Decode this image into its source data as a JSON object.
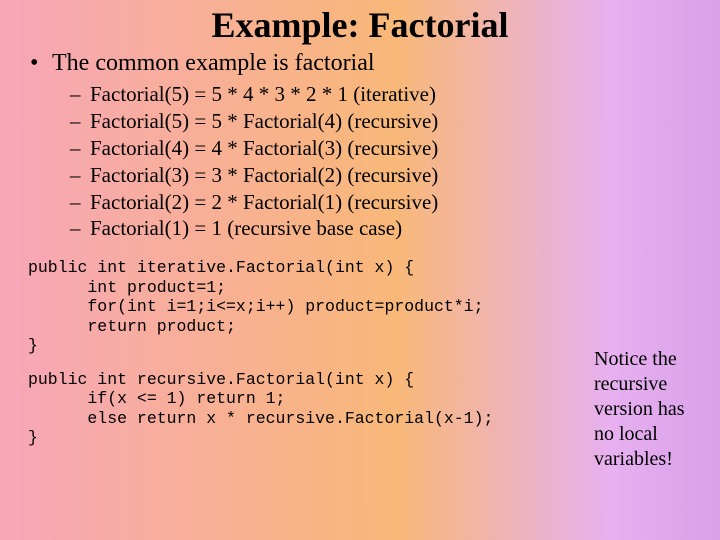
{
  "title": "Example:  Factorial",
  "bullet": "The common example is factorial",
  "subs": [
    "Factorial(5) = 5 * 4 * 3 * 2 * 1 (iterative)",
    "Factorial(5) = 5 * Factorial(4) (recursive)",
    "Factorial(4) = 4 * Factorial(3) (recursive)",
    "Factorial(3) = 3 * Factorial(2) (recursive)",
    "Factorial(2) = 2 * Factorial(1) (recursive)",
    "Factorial(1) = 1 (recursive base case)"
  ],
  "code1": "public int iterative.Factorial(int x) {\n      int product=1;\n      for(int i=1;i<=x;i++) product=product*i;\n      return product;\n}",
  "code2": "public int recursive.Factorial(int x) {\n      if(x <= 1) return 1;\n      else return x * recursive.Factorial(x-1);\n}",
  "note": "Notice the recursive version has no local variables!"
}
